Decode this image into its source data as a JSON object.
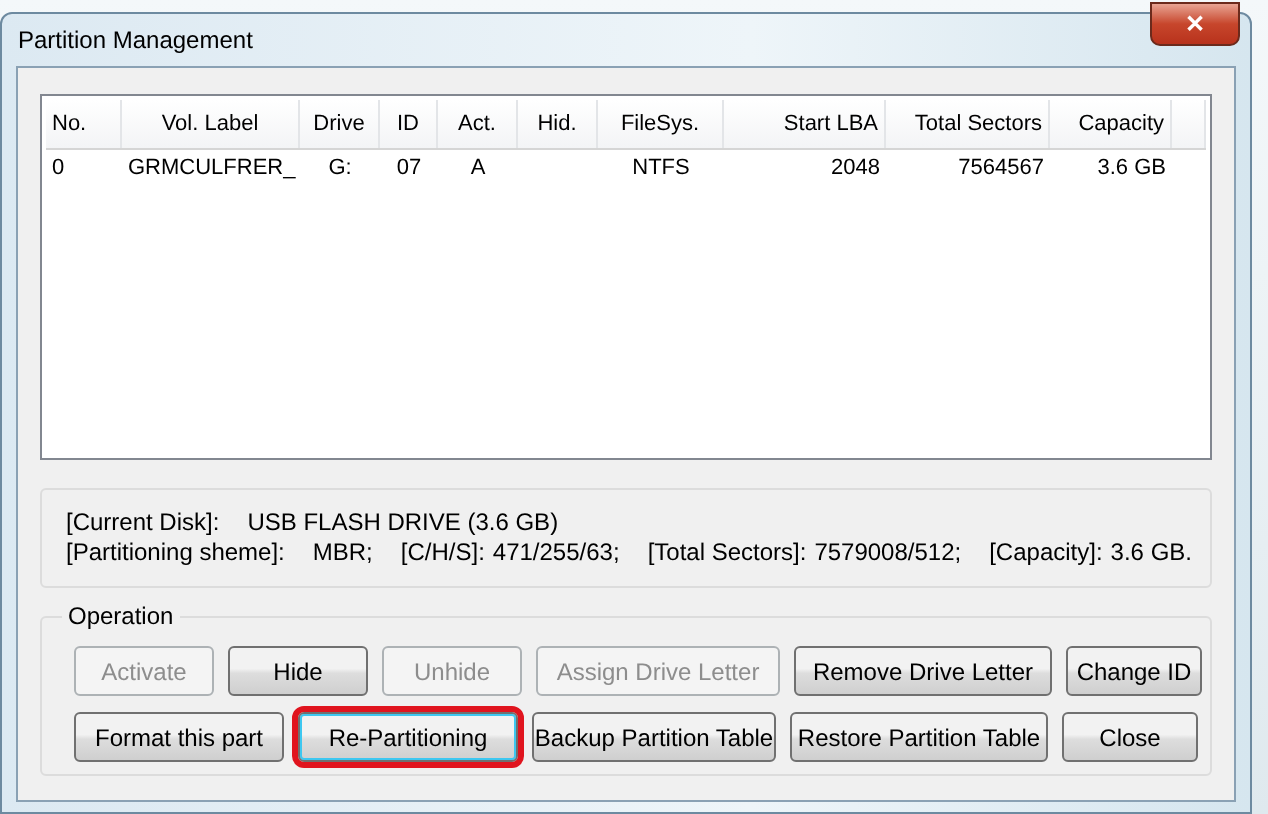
{
  "window": {
    "title": "Partition Management",
    "close": "✕"
  },
  "table": {
    "columns": [
      "No.",
      "Vol. Label",
      "Drive",
      "ID",
      "Act.",
      "Hid.",
      "FileSys.",
      "Start LBA",
      "Total Sectors",
      "Capacity"
    ],
    "rows": [
      [
        "0",
        "GRMCULFRER_",
        "G:",
        "07",
        "A",
        "",
        "NTFS",
        "2048",
        "7564567",
        "3.6 GB"
      ]
    ]
  },
  "disk_info": {
    "lines": [
      [
        {
          "label": "[Current Disk]:",
          "value": "USB FLASH DRIVE (3.6 GB)"
        }
      ],
      [
        {
          "label": "[Partitioning sheme]:",
          "value": "MBR;"
        },
        {
          "label": "[C/H/S]:",
          "value": "471/255/63;"
        },
        {
          "label": "[Total Sectors]:",
          "value": "7579008/512;"
        },
        {
          "label": "[Capacity]:",
          "value": "3.6 GB."
        }
      ]
    ]
  },
  "operation": {
    "title": "Operation",
    "buttons": [
      {
        "label": "Activate",
        "disabled": true,
        "highlighted": false
      },
      {
        "label": "Hide",
        "disabled": false,
        "highlighted": false
      },
      {
        "label": "Unhide",
        "disabled": true,
        "highlighted": false
      },
      {
        "label": "Assign Drive Letter",
        "disabled": true,
        "highlighted": false
      },
      {
        "label": "Remove Drive Letter",
        "disabled": false,
        "highlighted": false
      },
      {
        "label": "Change ID",
        "disabled": false,
        "highlighted": false
      },
      {
        "label": "Format this part",
        "disabled": false,
        "highlighted": false
      },
      {
        "label": "Re-Partitioning",
        "disabled": false,
        "highlighted": true
      },
      {
        "label": "Backup Partition Table",
        "disabled": false,
        "highlighted": false
      },
      {
        "label": "Restore Partition Table",
        "disabled": false,
        "highlighted": false
      },
      {
        "label": "Close",
        "disabled": false,
        "highlighted": false
      }
    ]
  }
}
